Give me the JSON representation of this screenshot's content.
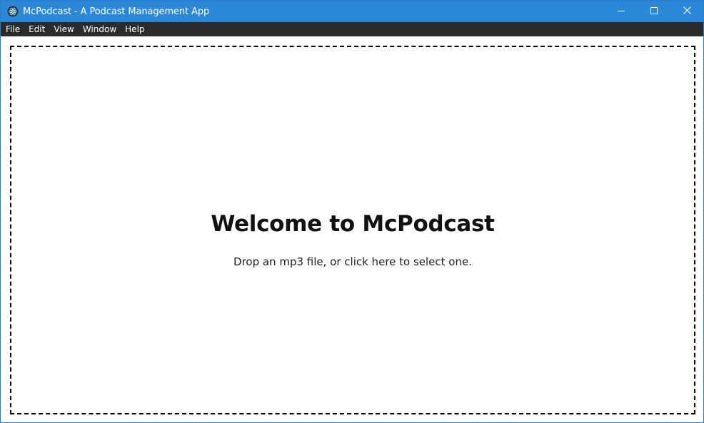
{
  "window": {
    "title": "McPodcast - A Podcast Management App",
    "app_icon": "electron-atom-icon",
    "controls": {
      "minimize": "minimize-icon",
      "maximize": "maximize-icon",
      "close": "close-icon"
    },
    "colors": {
      "titlebar": "#2b88d8",
      "menubar": "#2b2b2b",
      "content": "#ffffff"
    }
  },
  "menu": {
    "items": [
      {
        "label": "File"
      },
      {
        "label": "Edit"
      },
      {
        "label": "View"
      },
      {
        "label": "Window"
      },
      {
        "label": "Help"
      }
    ]
  },
  "main": {
    "heading": "Welcome to McPodcast",
    "instruction": "Drop an mp3 file, or click here to select one."
  }
}
